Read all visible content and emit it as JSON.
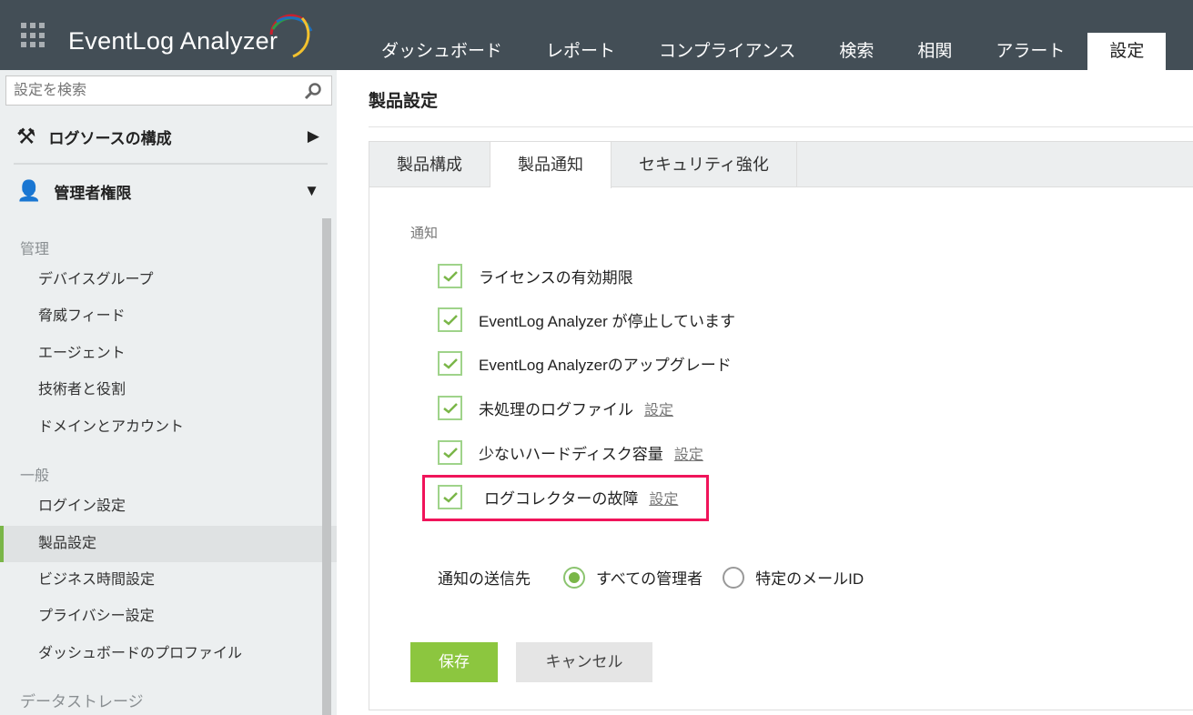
{
  "header": {
    "app_name": "EventLog Analyzer",
    "nav": [
      "ダッシュボード",
      "レポート",
      "コンプライアンス",
      "検索",
      "相関",
      "アラート",
      "設定"
    ],
    "active_nav": "設定"
  },
  "sidebar": {
    "search_placeholder": "設定を検索",
    "sections": [
      {
        "label": "ログソースの構成"
      },
      {
        "label": "管理者権限"
      }
    ],
    "groups": [
      {
        "label": "管理",
        "items": [
          "デバイスグループ",
          "脅威フィード",
          "エージェント",
          "技術者と役割",
          "ドメインとアカウント"
        ]
      },
      {
        "label": "一般",
        "items": [
          "ログイン設定",
          "製品設定",
          "ビジネス時間設定",
          "プライバシー設定",
          "ダッシュボードのプロファイル"
        ]
      },
      {
        "label": "データストレージ"
      }
    ],
    "active_item": "製品設定"
  },
  "main": {
    "title": "製品設定",
    "tabs": [
      "製品構成",
      "製品通知",
      "セキュリティ強化"
    ],
    "active_tab": "製品通知",
    "notif_label": "通知",
    "notifications": [
      {
        "label": "ライセンスの有効期限",
        "checked": true
      },
      {
        "label": "EventLog Analyzer が停止しています",
        "checked": true
      },
      {
        "label": "EventLog Analyzerのアップグレード",
        "checked": true
      },
      {
        "label": "未処理のログファイル",
        "checked": true,
        "link": "設定"
      },
      {
        "label": "少ないハードディスク容量",
        "checked": true,
        "link": "設定"
      },
      {
        "label": "ログコレクターの故障",
        "checked": true,
        "link": "設定"
      }
    ],
    "send_to": {
      "label": "通知の送信先",
      "options": [
        "すべての管理者",
        "特定のメールID"
      ],
      "selected": "すべての管理者"
    },
    "save": "保存",
    "cancel": "キャンセル"
  },
  "colors": {
    "header_bg": "#434e56",
    "accent_green": "#8cc63f",
    "highlight": "#f0145a"
  }
}
